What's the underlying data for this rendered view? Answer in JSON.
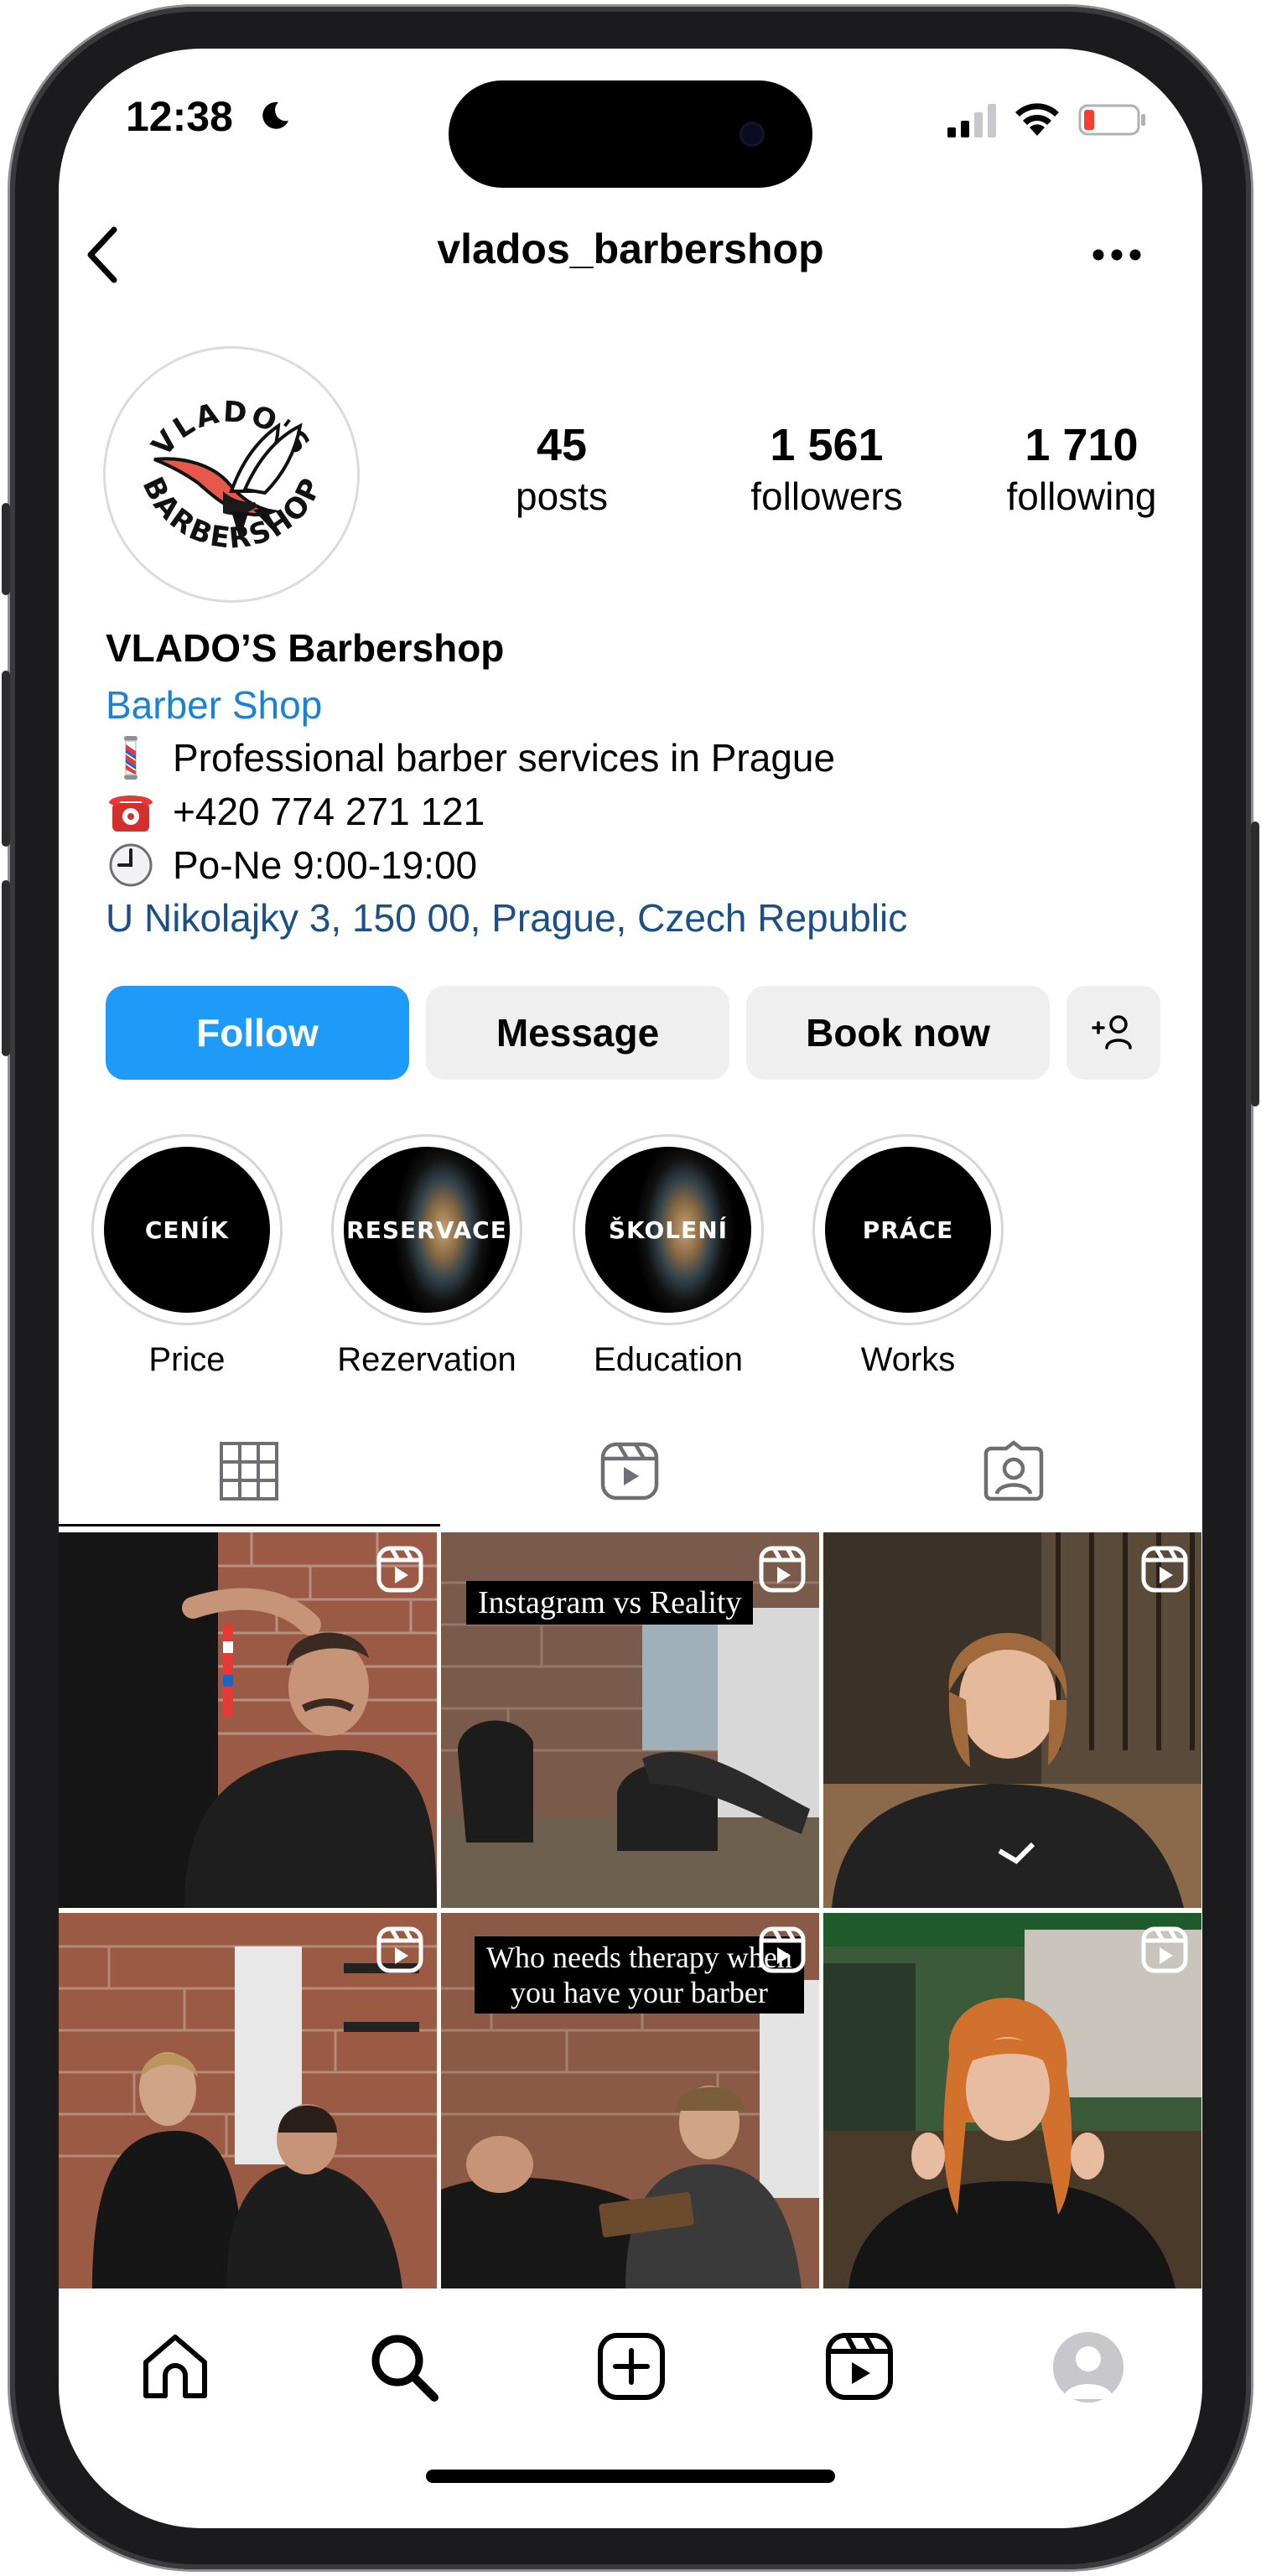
{
  "status": {
    "time": "12:38"
  },
  "header": {
    "username": "vlados_barbershop"
  },
  "profile": {
    "logo_text_top": "VLADO'S",
    "logo_text_bottom": "BARBERSHOP",
    "stats": [
      {
        "num": "45",
        "label": "posts"
      },
      {
        "num": "1 561",
        "label": "followers"
      },
      {
        "num": "1 710",
        "label": "following"
      }
    ],
    "display_name": "VLADO’S Barbershop",
    "category": "Barber Shop",
    "bio": [
      {
        "icon": "barber-pole-icon",
        "text": "Professional barber services in Prague"
      },
      {
        "icon": "telephone-icon",
        "text": "+420 774 271 121"
      },
      {
        "icon": "clock-icon",
        "text": "Po-Ne 9:00-19:00"
      }
    ],
    "address": "U Nikolajky 3, 150 00, Prague, Czech Republic"
  },
  "buttons": {
    "follow": "Follow",
    "message": "Message",
    "book": "Book now"
  },
  "highlights": [
    {
      "title": "CENÍK",
      "label": "Price"
    },
    {
      "title": "RESERVACE",
      "label": "Rezervation"
    },
    {
      "title": "ŠKOLENÍ",
      "label": "Education"
    },
    {
      "title": "PRÁCE",
      "label": "Works"
    }
  ],
  "grid": {
    "captions": [
      "Instagram vs Reality",
      "Who needs therapy when",
      "you have your barber"
    ]
  },
  "colors": {
    "follow_blue": "#1e9bf8",
    "link_blue": "#1a82d6",
    "address_blue": "#1b4f86",
    "button_grey": "#efefef"
  }
}
